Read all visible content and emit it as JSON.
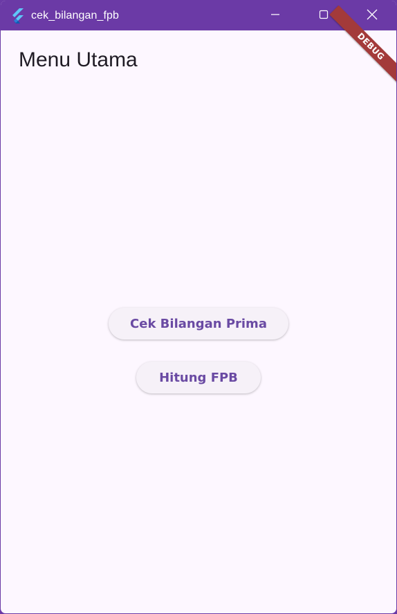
{
  "window": {
    "title": "cek_bilangan_fpb",
    "icon": "flutter-logo-icon",
    "controls": {
      "minimize_icon": "minimize-icon",
      "maximize_icon": "maximize-icon",
      "close_icon": "close-icon"
    }
  },
  "page": {
    "title": "Menu Utama",
    "buttons": [
      {
        "label": "Cek Bilangan Prima"
      },
      {
        "label": "Hitung FPB"
      }
    ]
  },
  "debug_banner": {
    "label": "DEBUG"
  },
  "colors": {
    "titlebar": "#6b3aa6",
    "background": "#fdf7ff",
    "button_text": "#6a4aa3",
    "button_bg": "#f6f1f8",
    "debug_banner": "#a33a3a"
  }
}
